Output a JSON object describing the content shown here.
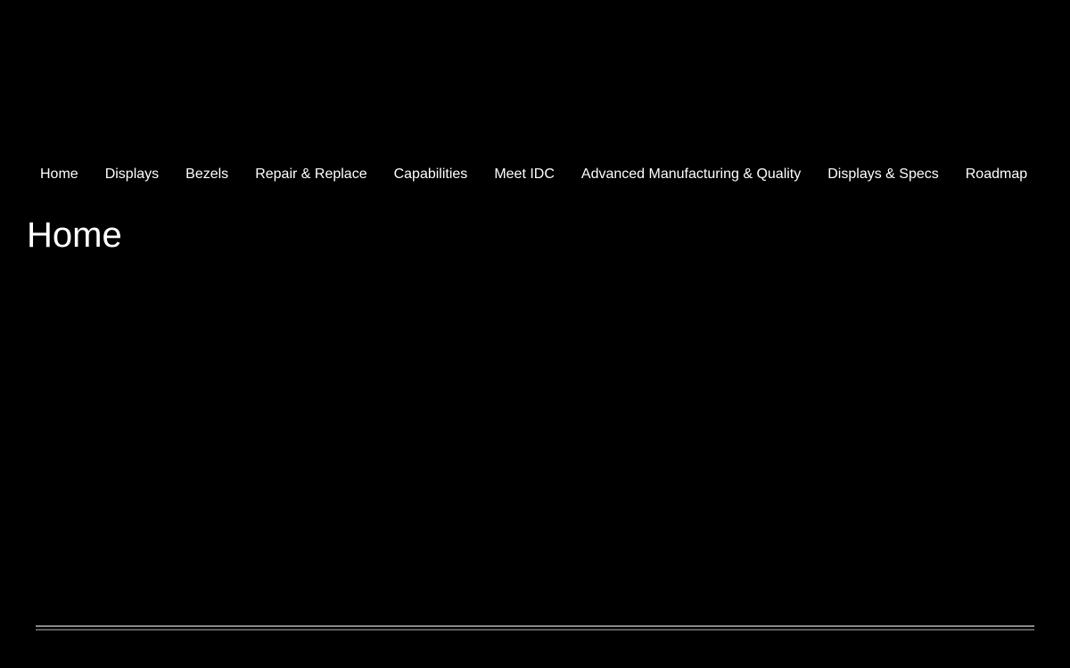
{
  "nav": {
    "items": [
      {
        "label": "Home"
      },
      {
        "label": "Displays"
      },
      {
        "label": "Bezels"
      },
      {
        "label": "Repair & Replace"
      },
      {
        "label": "Capabilities"
      },
      {
        "label": "Meet IDC"
      },
      {
        "label": "Advanced Manufacturing & Quality"
      },
      {
        "label": "Displays & Specs"
      },
      {
        "label": "Roadmap"
      }
    ]
  },
  "page": {
    "title": "Home"
  },
  "colors": {
    "background": "#000000",
    "text": "#ffffff",
    "rule": "#8a8a8a"
  }
}
